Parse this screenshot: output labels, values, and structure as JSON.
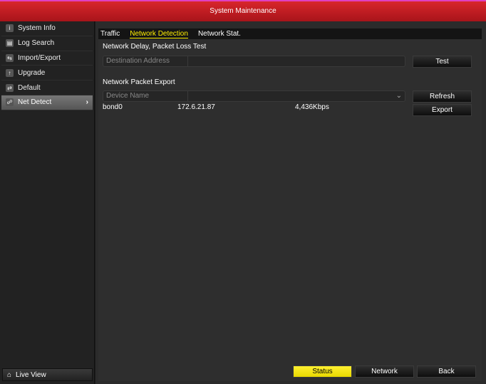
{
  "window": {
    "title": "System Maintenance"
  },
  "sidebar": {
    "items": [
      {
        "label": "System Info",
        "icon": "info-icon",
        "glyph": "i"
      },
      {
        "label": "Log Search",
        "icon": "log-icon",
        "glyph": "▤"
      },
      {
        "label": "Import/Export",
        "icon": "import-export-icon",
        "glyph": "⇆"
      },
      {
        "label": "Upgrade",
        "icon": "upgrade-icon",
        "glyph": "↑"
      },
      {
        "label": "Default",
        "icon": "default-icon",
        "glyph": "⇄"
      },
      {
        "label": "Net Detect",
        "icon": "net-detect-icon",
        "glyph": "☍",
        "active": true
      }
    ],
    "live_view": "Live View"
  },
  "tabs": [
    {
      "label": "Traffic"
    },
    {
      "label": "Network Detection",
      "active": true
    },
    {
      "label": "Network Stat."
    }
  ],
  "delay_test": {
    "title": "Network Delay, Packet Loss Test",
    "field_label": "Destination Address",
    "value": "",
    "button": "Test"
  },
  "packet_export": {
    "title": "Network Packet Export",
    "field_label": "Device Name",
    "value": "",
    "refresh": "Refresh",
    "export": "Export",
    "row": {
      "device": "bond0",
      "ip": "172.6.21.87",
      "rate": "4,436Kbps"
    }
  },
  "footer": {
    "status": "Status",
    "network": "Network",
    "back": "Back"
  },
  "colors": {
    "accent": "#ffef00",
    "title_bar": "#c41e24"
  }
}
